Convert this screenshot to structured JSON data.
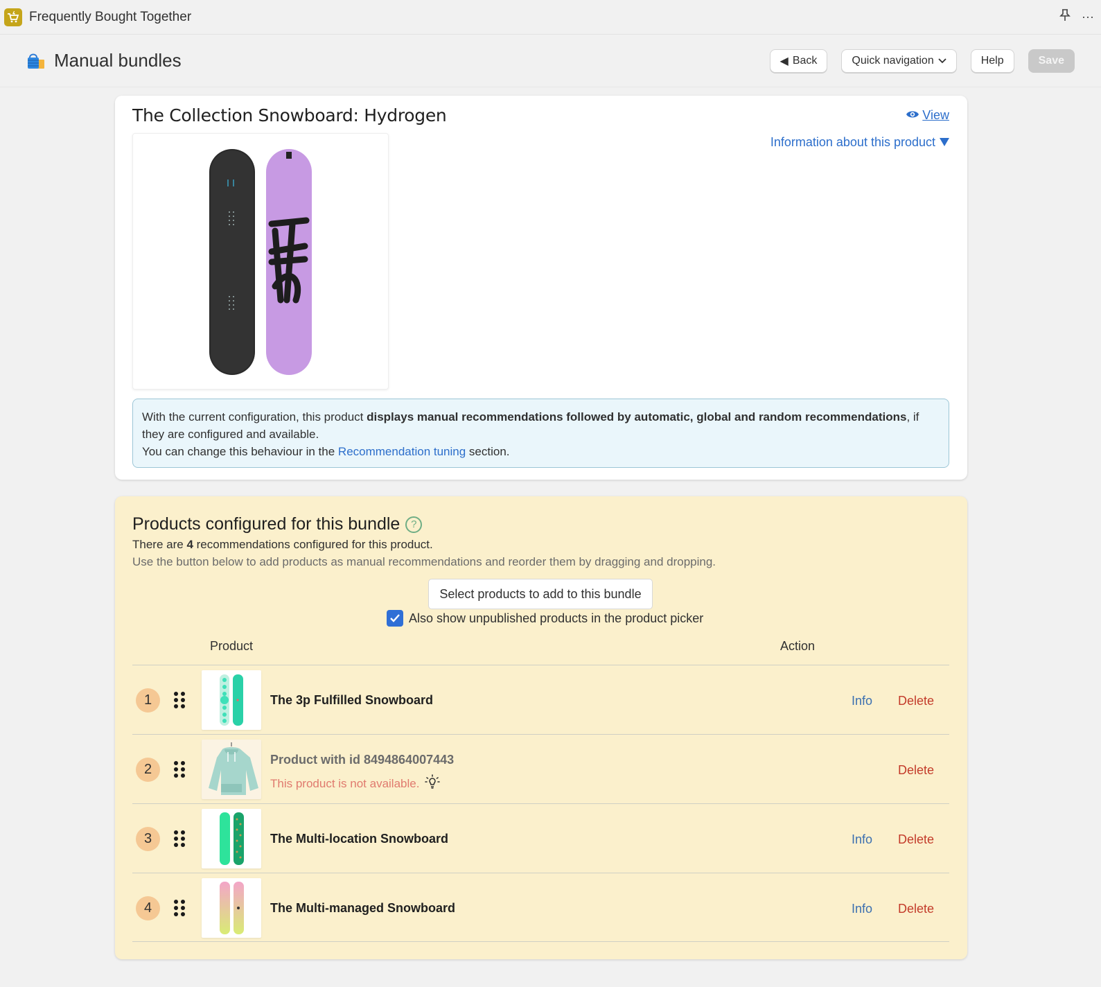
{
  "appbar": {
    "title": "Frequently Bought Together",
    "icons": [
      "cart-lightning-logo",
      "pin-icon",
      "more-icon"
    ],
    "more_label": "···"
  },
  "header": {
    "title": "Manual bundles",
    "icon": "shopping-bag-icon",
    "buttons": {
      "back": "Back",
      "quick_nav": "Quick navigation",
      "help": "Help",
      "save": "Save"
    }
  },
  "product": {
    "title": "The Collection Snowboard: Hydrogen",
    "view_label": "View",
    "info_toggle": "Information about this product",
    "notice": {
      "part1": "With the current configuration, this product ",
      "bold": "displays manual recommendations followed by automatic, global and random recommendations",
      "part2": ", if they are configured and available.",
      "line2_pre": "You can change this behaviour in the ",
      "line2_link": "Recommendation tuning",
      "line2_post": " section."
    }
  },
  "bundle": {
    "title": "Products configured for this bundle",
    "help_icon": "?",
    "count_pre": "There are ",
    "count": "4",
    "count_post": " recommendations configured for this product.",
    "instructions": "Use the button below to add products as manual recommendations and reorder them by dragging and dropping.",
    "select_button": "Select products to add to this bundle",
    "checkbox_label": "Also show unpublished products in the product picker",
    "checkbox_checked": true,
    "columns": {
      "product": "Product",
      "action": "Action"
    },
    "rows": [
      {
        "index": "1",
        "name": "The 3p Fulfilled Snowboard",
        "available": true,
        "info": "Info",
        "delete": "Delete"
      },
      {
        "index": "2",
        "name": "Product with id 8494864007443",
        "available": false,
        "warning": "This product is not available.",
        "delete": "Delete"
      },
      {
        "index": "3",
        "name": "The Multi-location Snowboard",
        "available": true,
        "info": "Info",
        "delete": "Delete"
      },
      {
        "index": "4",
        "name": "The Multi-managed Snowboard",
        "available": true,
        "info": "Info",
        "delete": "Delete"
      }
    ]
  },
  "colors": {
    "accent": "#2c6ecb",
    "bundle_bg": "#fbf0cc",
    "delete": "#c33b2a",
    "warning": "#e07a6e",
    "badge": "#f5c894"
  }
}
